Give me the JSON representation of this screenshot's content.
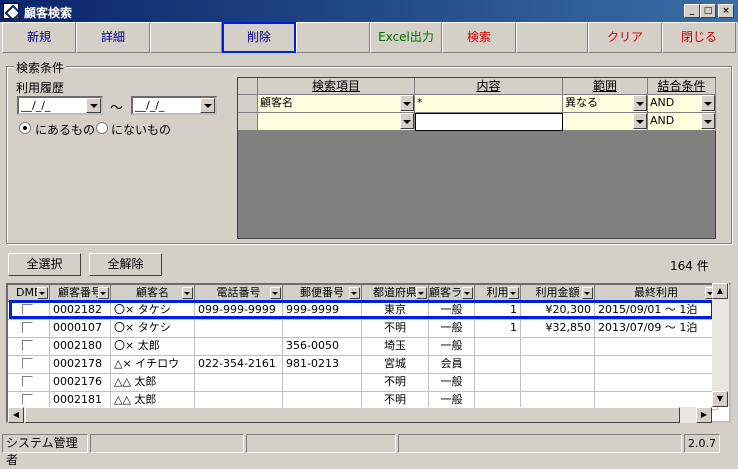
{
  "window": {
    "title": "顧客検索",
    "minimize": "_",
    "maximize": "□",
    "close": "×"
  },
  "toolbar": {
    "new": "新規",
    "detail": "詳細",
    "delete": "削除",
    "excel": "Excel出力",
    "search": "検索",
    "clear": "クリア",
    "close": "閉じる"
  },
  "conditions": {
    "legend": "検索条件",
    "history_label": "利用履歴",
    "date_from": "__/_/_",
    "date_to": "__/_/_",
    "tilde": "～",
    "radio_has": "にあるもの",
    "radio_not": "にないもの"
  },
  "criteria": {
    "headers": [
      "検索項目",
      "内容",
      "範囲",
      "結合条件"
    ],
    "rows": [
      {
        "item": "顧客名",
        "content": "*",
        "range": "異なる",
        "join": "AND"
      },
      {
        "item": "",
        "content": "",
        "range": "",
        "join": "AND"
      }
    ]
  },
  "select": {
    "all": "全選択",
    "none": "全解除",
    "count": "164 件"
  },
  "results": {
    "headers": [
      "DME",
      "顧客番号",
      "顧客名",
      "電話番号",
      "郵便番号",
      "都道府県",
      "顧客ランク",
      "利用",
      "利用金額",
      "最終利用"
    ],
    "rows": [
      {
        "no": "0002182",
        "name": "〇× タケシ",
        "tel": "099-999-9999",
        "zip": "999-9999",
        "pref": "東京",
        "rank": "一般",
        "use": "1",
        "amount": "¥20,300",
        "last": "2015/09/01 ～ 1泊"
      },
      {
        "no": "0000107",
        "name": "〇× タケシ",
        "tel": "",
        "zip": "",
        "pref": "不明",
        "rank": "一般",
        "use": "1",
        "amount": "¥32,850",
        "last": "2013/07/09 ～ 1泊"
      },
      {
        "no": "0002180",
        "name": "〇× 太郎",
        "tel": "",
        "zip": "356-0050",
        "pref": "埼玉",
        "rank": "一般",
        "use": "",
        "amount": "",
        "last": ""
      },
      {
        "no": "0002178",
        "name": "△× イチロウ",
        "tel": "022-354-2161",
        "zip": "981-0213",
        "pref": "宮城",
        "rank": "会員",
        "use": "",
        "amount": "",
        "last": ""
      },
      {
        "no": "0002176",
        "name": "△△ 太郎",
        "tel": "",
        "zip": "",
        "pref": "不明",
        "rank": "一般",
        "use": "",
        "amount": "",
        "last": ""
      },
      {
        "no": "0002181",
        "name": "△△ 太郎",
        "tel": "",
        "zip": "",
        "pref": "不明",
        "rank": "一般",
        "use": "",
        "amount": "",
        "last": ""
      }
    ]
  },
  "status": {
    "user": "システム管理者",
    "version": "2.0.7"
  }
}
